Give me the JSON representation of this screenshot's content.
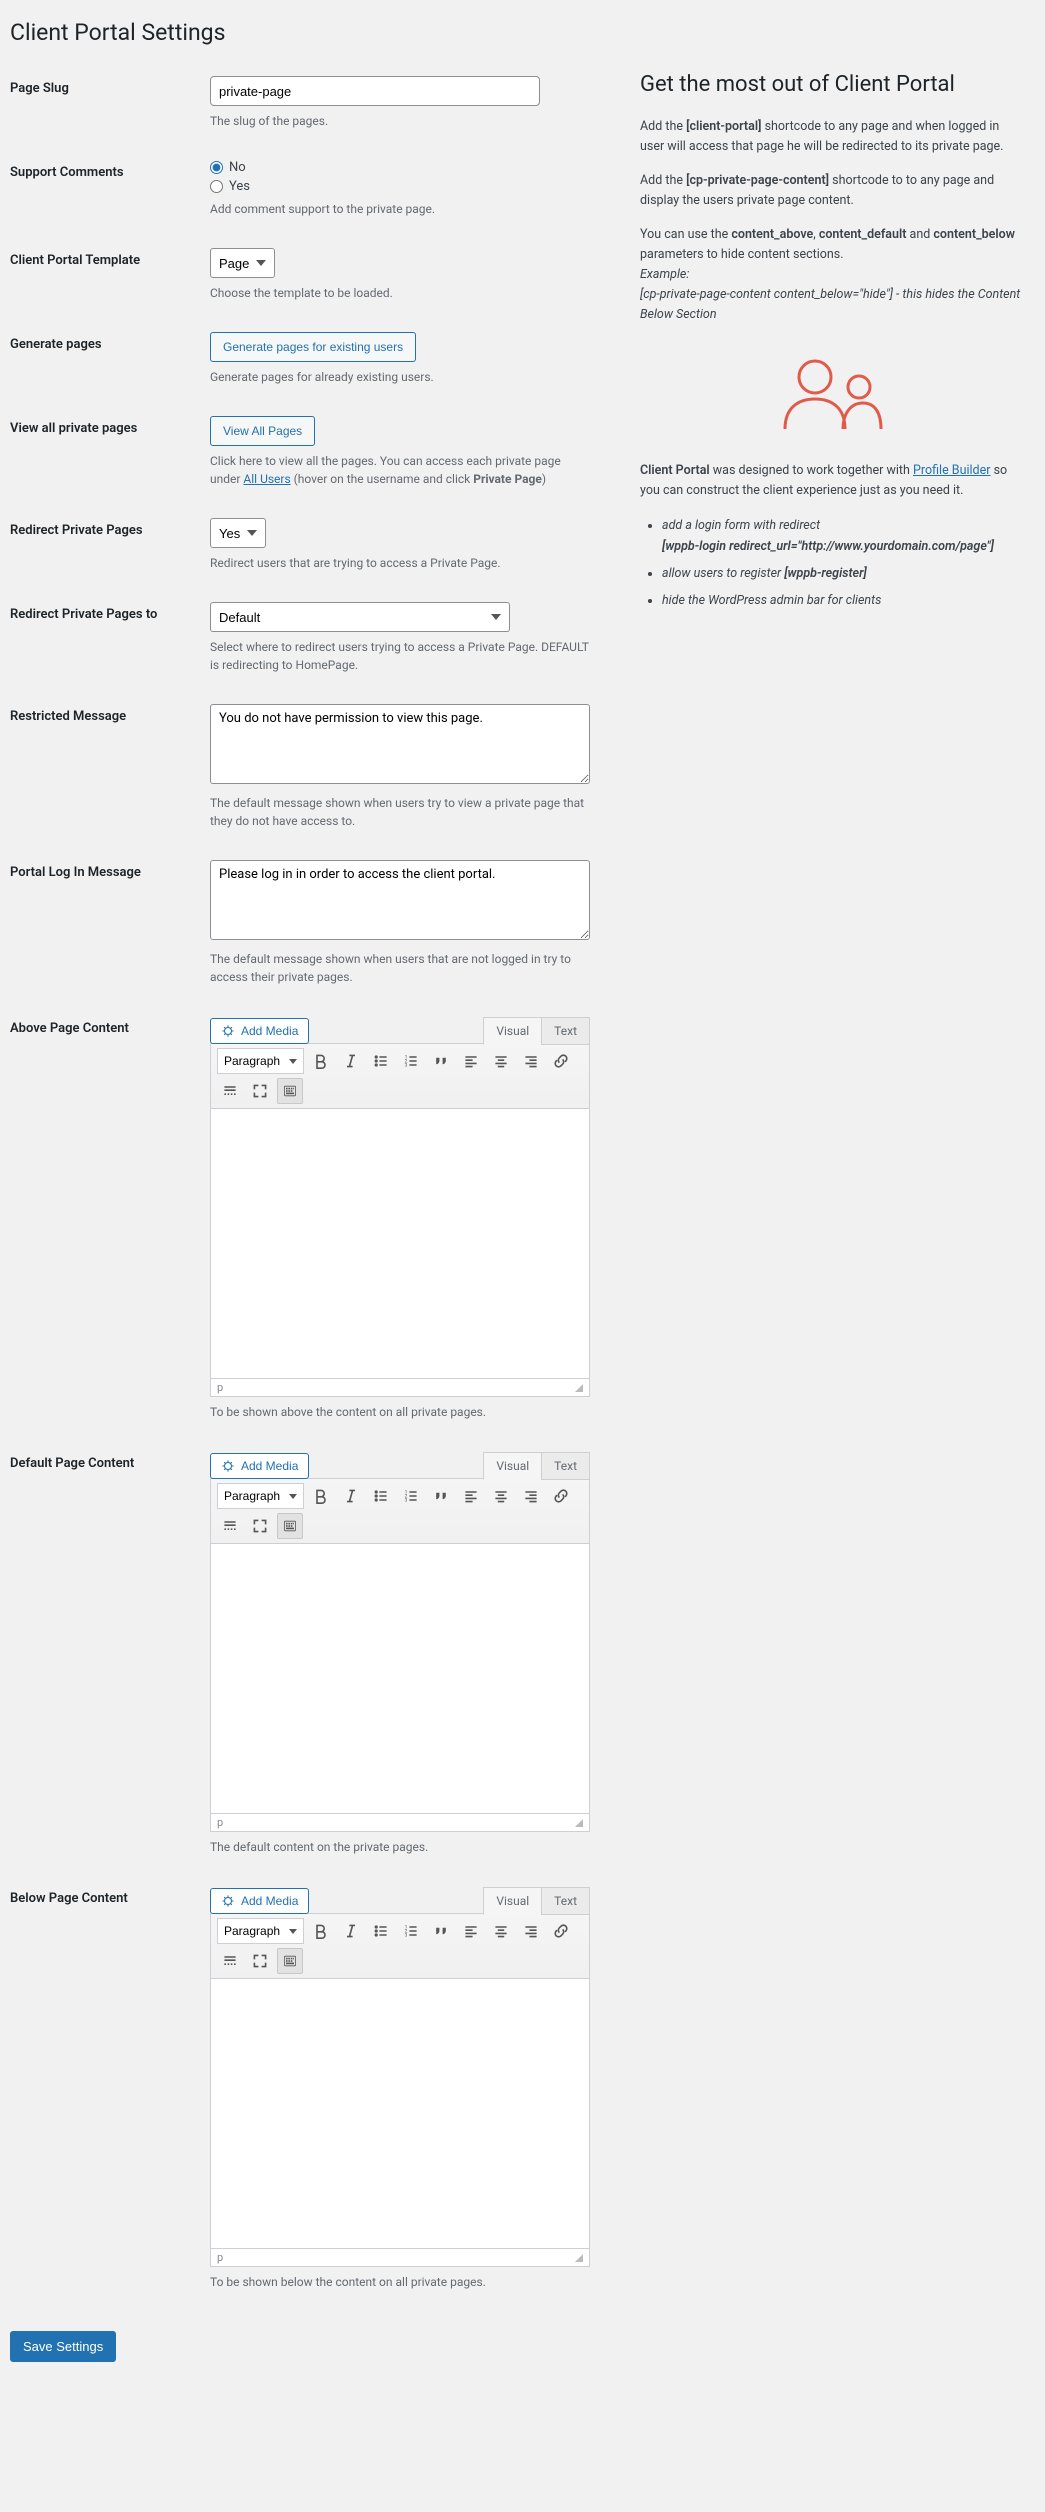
{
  "page_title": "Client Portal Settings",
  "fields": {
    "page_slug": {
      "label": "Page Slug",
      "value": "private-page",
      "desc": "The slug of the pages."
    },
    "support_comments": {
      "label": "Support Comments",
      "opt_no": "No",
      "opt_yes": "Yes",
      "desc": "Add comment support to the private page."
    },
    "template": {
      "label": "Client Portal Template",
      "value": "Page",
      "desc": "Choose the template to be loaded."
    },
    "generate": {
      "label": "Generate pages",
      "button": "Generate pages for existing users",
      "desc": "Generate pages for already existing users."
    },
    "view_all": {
      "label": "View all private pages",
      "button": "View All Pages",
      "desc_pre": "Click here to view all the pages. You can access each private page under ",
      "link": "All Users",
      "desc_post": " (hover on the username and click ",
      "bold": "Private Page",
      "desc_close": ")"
    },
    "redirect": {
      "label": "Redirect Private Pages",
      "value": "Yes",
      "desc": "Redirect users that are trying to access a Private Page."
    },
    "redirect_to": {
      "label": "Redirect Private Pages to",
      "value": "Default",
      "desc": "Select where to redirect users trying to access a Private Page. DEFAULT is redirecting to HomePage."
    },
    "restricted": {
      "label": "Restricted Message",
      "value": "You do not have permission to view this page.",
      "desc": "The default message shown when users try to view a private page that they do not have access to."
    },
    "login_msg": {
      "label": "Portal Log In Message",
      "value": "Please log in in order to access the client portal.",
      "desc": "The default message shown when users that are not logged in try to access their private pages."
    },
    "above": {
      "label": "Above Page Content",
      "desc": "To be shown above the content on all private pages."
    },
    "default": {
      "label": "Default Page Content",
      "desc": "The default content on the private pages."
    },
    "below": {
      "label": "Below Page Content",
      "desc": "To be shown below the content on all private pages."
    }
  },
  "editor": {
    "add_media": "Add Media",
    "tab_visual": "Visual",
    "tab_text": "Text",
    "paragraph": "Paragraph",
    "status_p": "p"
  },
  "save_button": "Save Settings",
  "sidebar": {
    "heading": "Get the most out of Client Portal",
    "p1_pre": "Add the ",
    "p1_b1": "[client-portal]",
    "p1_post": " shortcode to any page and when logged in user will access that page he will be redirected to its private page.",
    "p2_pre": "Add the ",
    "p2_b1": "[cp-private-page-content]",
    "p2_post": " shortcode to to any page and display the users private page content.",
    "p3_pre": "You can use the ",
    "p3_b1": "content_above",
    "p3_sep1": ", ",
    "p3_b2": "content_default",
    "p3_sep2": " and ",
    "p3_b3": "content_below",
    "p3_post": " parameters to hide content sections.",
    "p4_i1": "Example:",
    "p4_i2": "[cp-private-page-content content_below=\"hide\"] - this hides the Content Below Section",
    "p5_b1": "Client Portal",
    "p5_mid": " was designed to work together with ",
    "p5_link": "Profile Builder",
    "p5_post": " so you can construct the client experience just as you need it.",
    "li1_a": "add a login form with redirect",
    "li1_b": "[wppb-login redirect_url=\"http://www.yourdomain.com/page\"]",
    "li2_a": "allow users to register ",
    "li2_b": "[wppb-register]",
    "li3": "hide the WordPress admin bar for clients"
  }
}
